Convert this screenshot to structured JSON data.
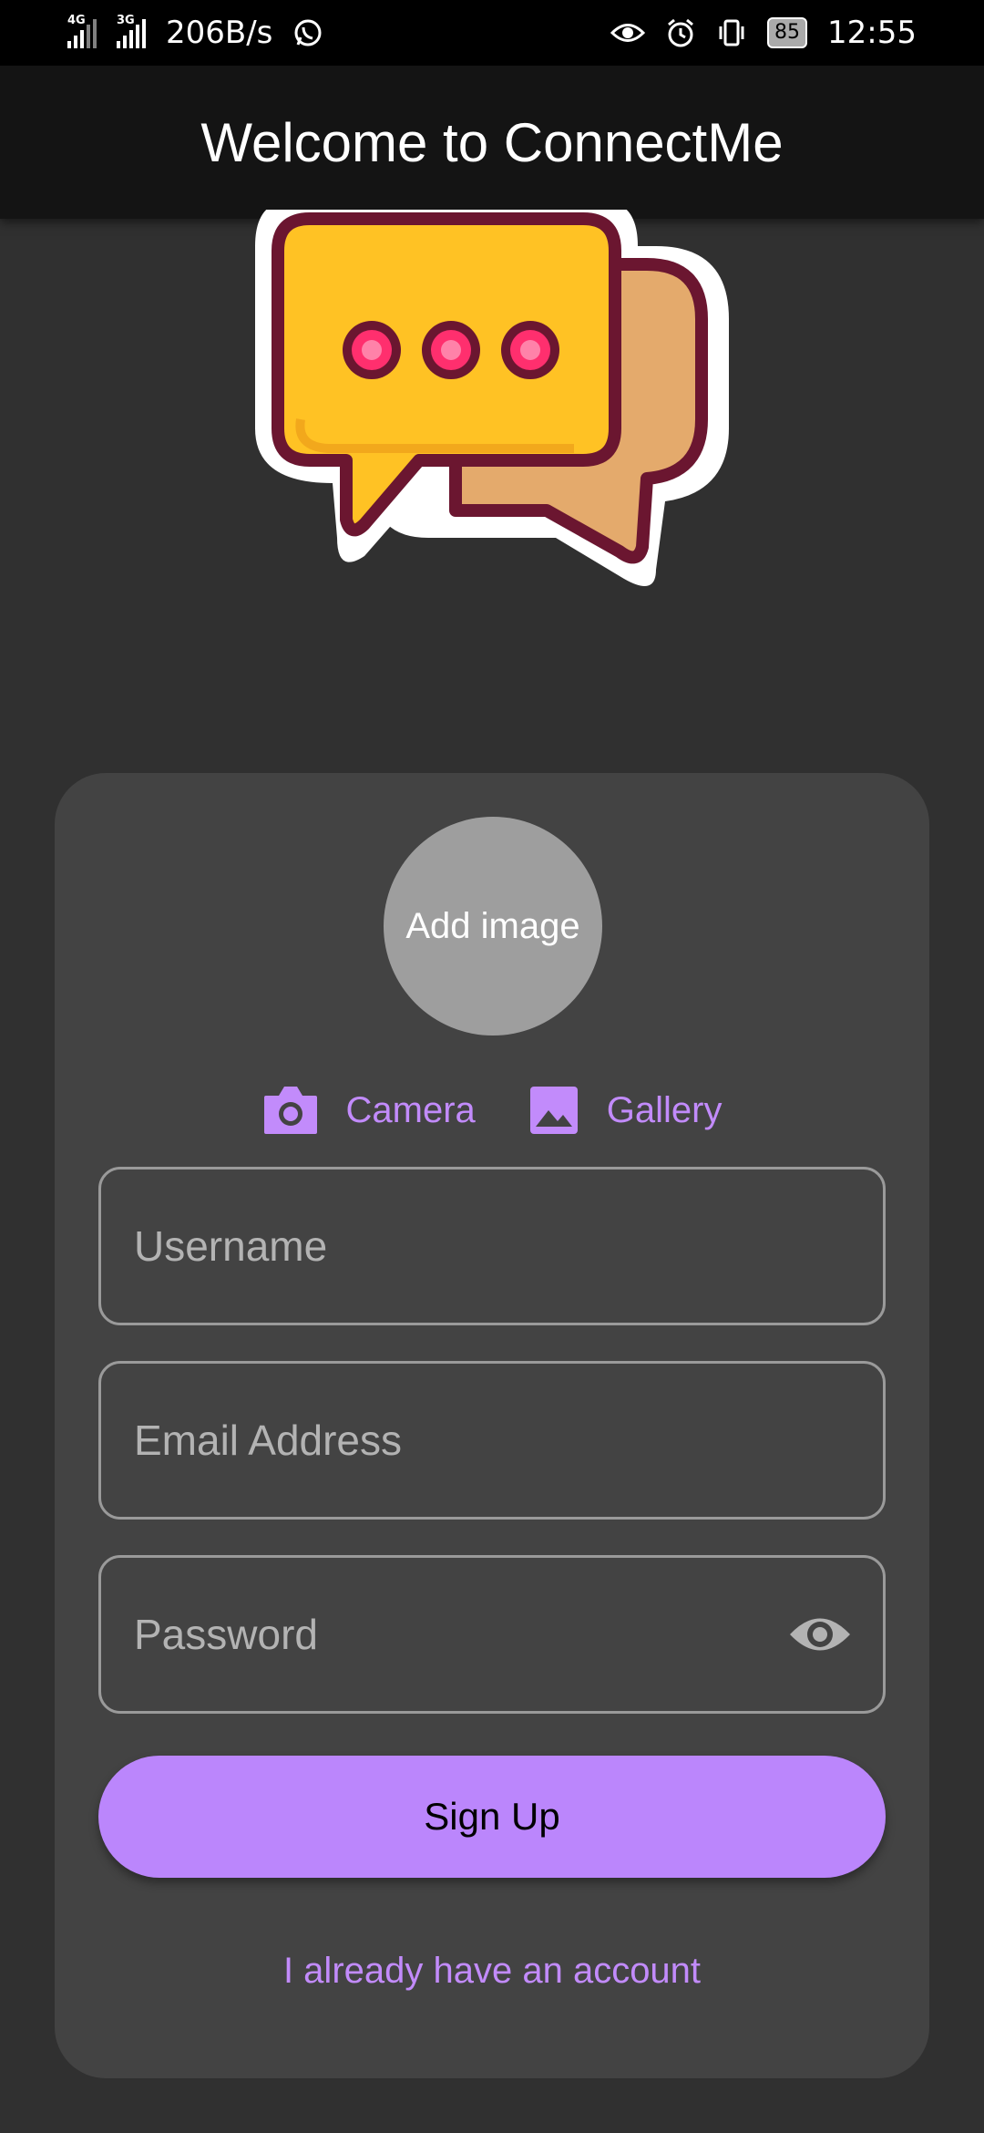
{
  "status_bar": {
    "net1": "4G",
    "net2": "3G",
    "speed": "206B/s",
    "battery": "85",
    "time": "12:55"
  },
  "app_bar": {
    "title": "Welcome to ConnectMe"
  },
  "logo": {
    "icon": "chat-bubbles-logo"
  },
  "form": {
    "avatar_label": "Add image",
    "camera_label": "Camera",
    "gallery_label": "Gallery",
    "username_placeholder": "Username",
    "email_placeholder": "Email Address",
    "password_placeholder": "Password",
    "signup_label": "Sign Up",
    "login_link": "I already have an account"
  },
  "colors": {
    "accent": "#bb86fc",
    "background": "#303030",
    "card": "#434343",
    "appbar": "#141414"
  }
}
